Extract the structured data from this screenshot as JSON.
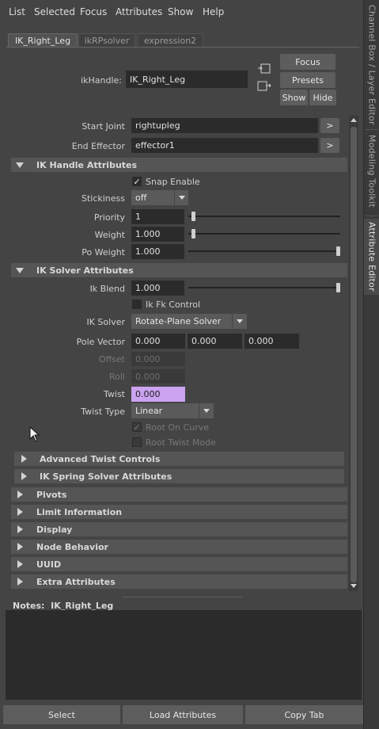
{
  "menu": [
    "List",
    "Selected",
    "Focus",
    "Attributes",
    "Show",
    "Help"
  ],
  "vertical_tabs": [
    "Channel Box / Layer Editor",
    "Modeling Toolkit",
    "Attribute Editor"
  ],
  "node_tabs": [
    "IK_Right_Leg",
    "ikRPsolver",
    "expression2"
  ],
  "header": {
    "ikhandle_label": "ikHandle:",
    "ikhandle_value": "IK_Right_Leg",
    "focus": "Focus",
    "presets": "Presets",
    "show": "Show",
    "hide": "Hide"
  },
  "joints": {
    "start_label": "Start Joint",
    "start_value": "rightupleg",
    "end_label": "End Effector",
    "end_value": "effector1",
    "go": ">"
  },
  "ik_handle_attrs": {
    "title": "IK Handle Attributes",
    "snap_enable": "Snap Enable",
    "stickiness_label": "Stickiness",
    "stickiness_value": "off",
    "priority_label": "Priority",
    "priority_value": "1",
    "priority_slider": 0.02,
    "weight_label": "Weight",
    "weight_value": "1.000",
    "weight_slider": 0.02,
    "po_weight_label": "Po Weight",
    "po_weight_value": "1.000",
    "po_weight_slider": 1.0
  },
  "ik_solver_attrs": {
    "title": "IK Solver Attributes",
    "ik_blend_label": "Ik Blend",
    "ik_blend_value": "1.000",
    "ik_blend_slider": 1.0,
    "ik_fk_control": "Ik Fk Control",
    "ik_solver_label": "IK Solver",
    "ik_solver_value": "Rotate-Plane Solver",
    "pole_vector_label": "Pole Vector",
    "pole_vector": [
      "0.000",
      "0.000",
      "0.000"
    ],
    "offset_label": "Offset",
    "offset_value": "0.000",
    "roll_label": "Roll",
    "roll_value": "0.000",
    "twist_label": "Twist",
    "twist_value": "0.000",
    "twist_type_label": "Twist Type",
    "twist_type_value": "Linear",
    "root_on_curve": "Root On Curve",
    "root_twist_mode": "Root Twist Mode"
  },
  "subsections": [
    "Advanced Twist Controls",
    "IK Spring Solver Attributes"
  ],
  "sections": [
    "Pivots",
    "Limit Information",
    "Display",
    "Node Behavior",
    "UUID",
    "Extra Attributes"
  ],
  "notes": {
    "label": "Notes:",
    "node": "IK_Right_Leg"
  },
  "bottom": {
    "select": "Select",
    "load": "Load Attributes",
    "copy": "Copy Tab"
  },
  "check": "✓",
  "colors": {
    "background": "#444444",
    "field": "#2b2b2b",
    "section": "#555555",
    "twist_highlight": "#cba3f0"
  }
}
